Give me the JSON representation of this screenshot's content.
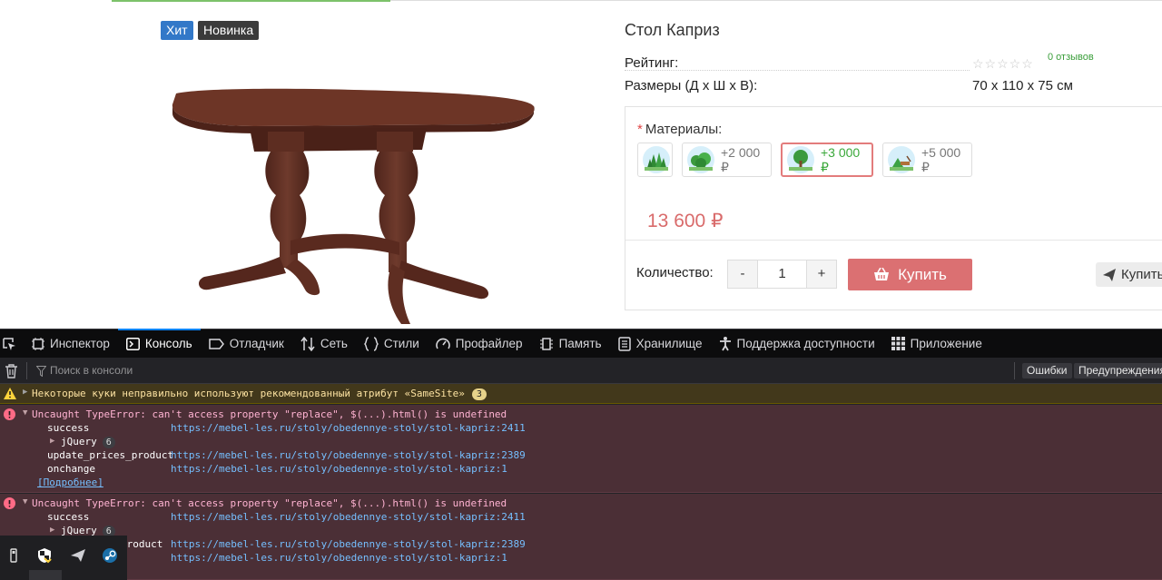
{
  "product": {
    "badges": [
      "Хит",
      "Новинка"
    ],
    "title": "Стол Каприз",
    "rating_label": "Рейтинг:",
    "stars": "☆☆☆☆☆",
    "reviews": "0 отзывов",
    "size_label": "Размеры (Д х Ш х В):",
    "size_value": "70 х 110 х 75 см",
    "materials_required": "*",
    "materials_label": "Материалы:",
    "materials": [
      {
        "price": ""
      },
      {
        "price": "+2 000 ₽"
      },
      {
        "price": "+3 000 ₽"
      },
      {
        "price": "+5 000 ₽"
      }
    ],
    "selected_material": 2,
    "price": "13 600 ₽",
    "qty_label": "Количество:",
    "qty_minus": "-",
    "qty_value": "1",
    "qty_plus": "+",
    "buy_label": "Купить",
    "buy_one_click_label": "Купить"
  },
  "devtools": {
    "tabs": [
      "Инспектор",
      "Консоль",
      "Отладчик",
      "Сеть",
      "Стили",
      "Профайлер",
      "Память",
      "Хранилище",
      "Поддержка доступности",
      "Приложение"
    ],
    "active_tab": "Консоль",
    "filter_placeholder": "Поиск в консоли",
    "errors_pill": "Ошибки",
    "warnings_pill": "Предупреждения",
    "warning": {
      "message": "Некоторые куки неправильно используют рекомендованный атрибут «SameSite»",
      "count": "3"
    },
    "errors": [
      {
        "message": "Uncaught TypeError: can't access property \"replace\", $(...).html() is undefined",
        "stack": [
          {
            "fn": "success",
            "url": "https://mebel-les.ru/stoly/obedennye-stoly/stol-kapriz:2411"
          },
          {
            "fn": "jQuery",
            "count": "6"
          },
          {
            "fn": "update_prices_product",
            "url": "https://mebel-les.ru/stoly/obedennye-stoly/stol-kapriz:2389"
          },
          {
            "fn": "onchange",
            "url": "https://mebel-les.ru/stoly/obedennye-stoly/stol-kapriz:1"
          }
        ],
        "more": "[Подробнее]"
      },
      {
        "message": "Uncaught TypeError: can't access property \"replace\", $(...).html() is undefined",
        "stack": [
          {
            "fn": "success",
            "url": "https://mebel-les.ru/stoly/obedennye-stoly/stol-kapriz:2411"
          },
          {
            "fn": "jQuery",
            "count": "6"
          },
          {
            "fn": "product",
            "url": "https://mebel-les.ru/stoly/obedennye-stoly/stol-kapriz:2389"
          },
          {
            "fn": "",
            "url": "https://mebel-les.ru/stoly/obedennye-stoly/stol-kapriz:1"
          }
        ]
      }
    ]
  },
  "colors": {
    "accent_blue": "#0a84ff",
    "buy_button": "#db7072",
    "price": "#d96b6b",
    "error_bg": "#4b2f36",
    "warning_bg": "#42381b"
  },
  "icons": [
    "trash-icon",
    "filter-icon",
    "inspector-icon",
    "console-icon",
    "debugger-icon",
    "network-icon",
    "style-icon",
    "profiler-icon",
    "memory-icon",
    "storage-icon",
    "accessibility-icon",
    "application-icon",
    "basket-icon",
    "send-icon",
    "warning-icon",
    "error-icon"
  ]
}
